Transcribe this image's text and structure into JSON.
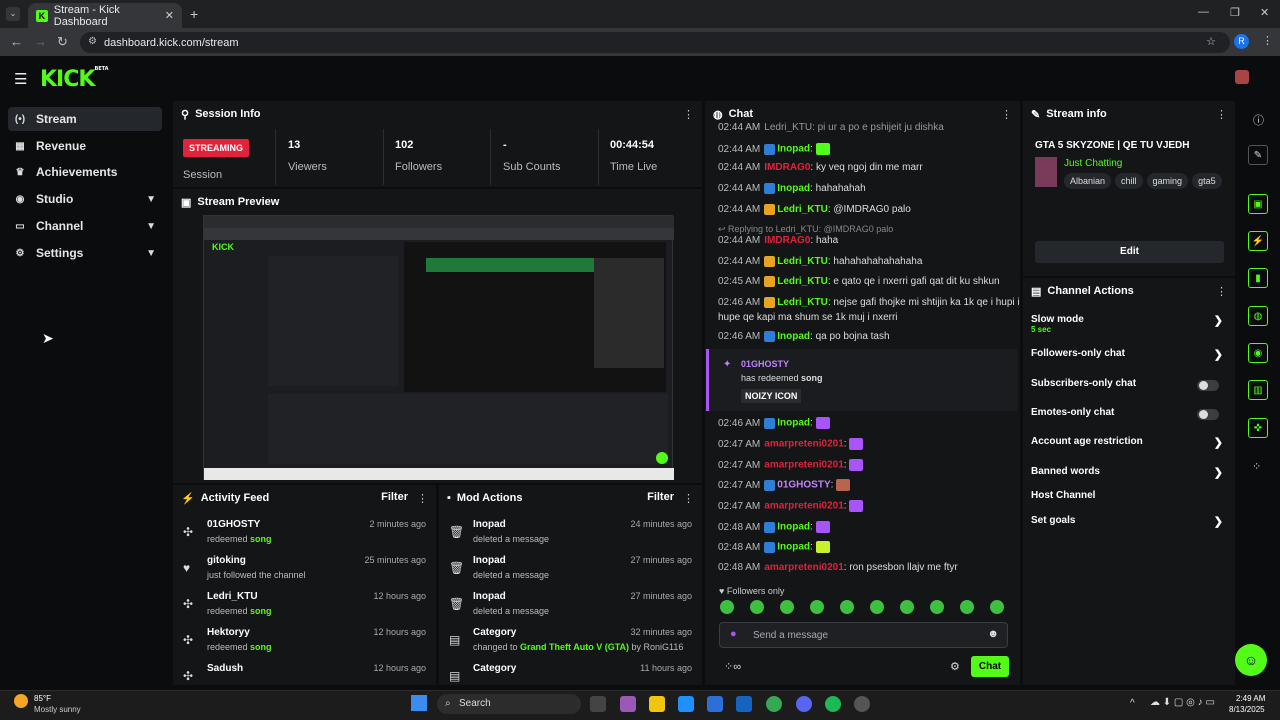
{
  "browser": {
    "tab_title": "Stream - Kick Dashboard",
    "url": "dashboard.kick.com/stream",
    "profile_initial": "R"
  },
  "app": {
    "logo": "KICK",
    "logo_badge": "BETA"
  },
  "sidebar": {
    "items": [
      {
        "label": "Stream",
        "icon": "broadcast-icon"
      },
      {
        "label": "Revenue",
        "icon": "bank-icon"
      },
      {
        "label": "Achievements",
        "icon": "trophy-icon"
      },
      {
        "label": "Studio",
        "icon": "studio-icon"
      },
      {
        "label": "Channel",
        "icon": "channel-icon"
      },
      {
        "label": "Settings",
        "icon": "gear-icon"
      }
    ]
  },
  "session": {
    "title": "Session Info",
    "status": "STREAMING",
    "session_label": "Session",
    "stats": [
      {
        "value": "13",
        "label": "Viewers"
      },
      {
        "value": "102",
        "label": "Followers"
      },
      {
        "value": "-",
        "label": "Sub Counts"
      },
      {
        "value": "00:44:54",
        "label": "Time Live"
      }
    ]
  },
  "preview": {
    "title": "Stream Preview"
  },
  "activity": {
    "title": "Activity Feed",
    "filter": "Filter",
    "items": [
      {
        "name": "01GHOSTY",
        "sub_pre": "redeemed ",
        "sub_hl": "song",
        "time": "2 minutes ago",
        "icon": "redeem-icon"
      },
      {
        "name": "gitoking",
        "sub_pre": "just followed the channel",
        "sub_hl": "",
        "time": "25 minutes ago",
        "icon": "heart-icon"
      },
      {
        "name": "Ledri_KTU",
        "sub_pre": "redeemed ",
        "sub_hl": "song",
        "time": "12 hours ago",
        "icon": "redeem-icon"
      },
      {
        "name": "Hektoryy",
        "sub_pre": "redeemed ",
        "sub_hl": "song",
        "time": "12 hours ago",
        "icon": "redeem-icon"
      },
      {
        "name": "Sadush",
        "sub_pre": "",
        "sub_hl": "",
        "time": "12 hours ago",
        "icon": "redeem-icon"
      }
    ]
  },
  "mod": {
    "title": "Mod Actions",
    "filter": "Filter",
    "items": [
      {
        "name": "Inopad",
        "sub_pre": "deleted a message",
        "sub_hl": "",
        "sub_post": "",
        "time": "24 minutes ago",
        "icon": "trash-icon"
      },
      {
        "name": "Inopad",
        "sub_pre": "deleted a message",
        "sub_hl": "",
        "sub_post": "",
        "time": "27 minutes ago",
        "icon": "trash-icon"
      },
      {
        "name": "Inopad",
        "sub_pre": "deleted a message",
        "sub_hl": "",
        "sub_post": "",
        "time": "27 minutes ago",
        "icon": "trash-icon"
      },
      {
        "name": "Category",
        "sub_pre": "changed to ",
        "sub_hl": "Grand Theft Auto V (GTA)",
        "sub_post": " by RoniG116",
        "time": "32 minutes ago",
        "icon": "category-icon"
      },
      {
        "name": "Category",
        "sub_pre": "",
        "sub_hl": "",
        "sub_post": "",
        "time": "11 hours ago",
        "icon": "category-icon"
      }
    ]
  },
  "chat": {
    "title": "Chat",
    "messages": [
      {
        "time": "02:44 AM",
        "badge": "mod",
        "user": "Inopad",
        "color": "#53fc18",
        "text": "",
        "emote": "#53fc18"
      },
      {
        "time": "02:44 AM",
        "badge": "",
        "user": "IMDRAG0",
        "color": "#e0223b",
        "text": "ky veq ngoj din me marr",
        "emote": ""
      },
      {
        "time": "02:44 AM",
        "badge": "mod",
        "user": "Inopad",
        "color": "#53fc18",
        "text": "hahahahah",
        "emote": ""
      },
      {
        "time": "02:44 AM",
        "badge": "vip",
        "user": "Ledri_KTU",
        "color": "#53fc18",
        "text": "@IMDRAG0 palo",
        "emote": ""
      },
      {
        "time": "02:44 AM",
        "badge": "",
        "user": "IMDRAG0",
        "color": "#e0223b",
        "text": "haha",
        "emote": ""
      },
      {
        "time": "02:44 AM",
        "badge": "vip",
        "user": "Ledri_KTU",
        "color": "#53fc18",
        "text": "hahahahahahahaha",
        "emote": ""
      },
      {
        "time": "02:45 AM",
        "badge": "vip",
        "user": "Ledri_KTU",
        "color": "#53fc18",
        "text": "e qato qe i nxerri gafi qat dit ku shkun",
        "emote": ""
      },
      {
        "time": "02:46 AM",
        "badge": "vip",
        "user": "Ledri_KTU",
        "color": "#53fc18",
        "text": "nejse gafi thojke mi shtijin ka 1k qe i hupi i",
        "emote": ""
      },
      {
        "time": "02:46 AM",
        "badge": "mod",
        "user": "Inopad",
        "color": "#53fc18",
        "text": "qa po bojna tash",
        "emote": ""
      },
      {
        "time": "02:46 AM",
        "badge": "mod",
        "user": "Inopad",
        "color": "#53fc18",
        "text": "",
        "emote": "#a855f7"
      },
      {
        "time": "02:47 AM",
        "badge": "",
        "user": "amarpreteni0201",
        "color": "#e0223b",
        "text": "",
        "emote": "#a855f7"
      },
      {
        "time": "02:47 AM",
        "badge": "",
        "user": "amarpreteni0201",
        "color": "#e0223b",
        "text": "",
        "emote": "#a855f7"
      },
      {
        "time": "02:47 AM",
        "badge": "mod",
        "user": "01GHOSTY",
        "color": "#c084fc",
        "text": "",
        "emote": "#b8664b"
      },
      {
        "time": "02:47 AM",
        "badge": "",
        "user": "amarpreteni0201",
        "color": "#e0223b",
        "text": "",
        "emote": "#a855f7"
      },
      {
        "time": "02:48 AM",
        "badge": "mod",
        "user": "Inopad",
        "color": "#53fc18",
        "text": "",
        "emote": "#a855f7"
      },
      {
        "time": "02:48 AM",
        "badge": "mod",
        "user": "Inopad",
        "color": "#53fc18",
        "text": "",
        "emote": "#c7f02e"
      },
      {
        "time": "02:48 AM",
        "badge": "",
        "user": "amarpreteni0201",
        "color": "#e0223b",
        "text": "ron psesbon llajv me ftyr",
        "emote": ""
      }
    ],
    "wrap_line": "hupe qe kapi ma shum se 1k muj i nxerri",
    "reply_note": "Replying to Ledri_KTU: @IMDRAG0 palo",
    "top_cut": "Ledri_KTU: pi ur a po e pshijeit ju dishka",
    "redeem": {
      "user": "01GHOSTY",
      "text_pre": "has redeemed ",
      "text_hl": "song",
      "value": "NOIZY ICON"
    },
    "followers_only": "Followers only",
    "placeholder": "Send a message",
    "send": "Chat"
  },
  "stream_info": {
    "title": "Stream info",
    "stream_title": "GTA 5 SKYZONE | QE TU VJEDH",
    "category": "Just Chatting",
    "tags": [
      "Albanian",
      "chill",
      "gaming",
      "gta5"
    ],
    "edit": "Edit"
  },
  "channel_actions": {
    "title": "Channel Actions",
    "items": [
      {
        "label": "Slow mode",
        "sub": "5 sec",
        "ctrl": "arrow"
      },
      {
        "label": "Followers-only chat",
        "sub": "",
        "ctrl": "arrow"
      },
      {
        "label": "Subscribers-only chat",
        "sub": "",
        "ctrl": "toggle"
      },
      {
        "label": "Emotes-only chat",
        "sub": "",
        "ctrl": "toggle"
      },
      {
        "label": "Account age restriction",
        "sub": "",
        "ctrl": "arrow"
      },
      {
        "label": "Banned words",
        "sub": "",
        "ctrl": "arrow"
      },
      {
        "label": "Host Channel",
        "sub": "",
        "ctrl": ""
      },
      {
        "label": "Set goals",
        "sub": "",
        "ctrl": "arrow"
      }
    ]
  },
  "taskbar": {
    "temp": "85°F",
    "weather": "Mostly sunny",
    "search": "Search",
    "time": "2:49 AM",
    "date": "8/13/2025"
  }
}
